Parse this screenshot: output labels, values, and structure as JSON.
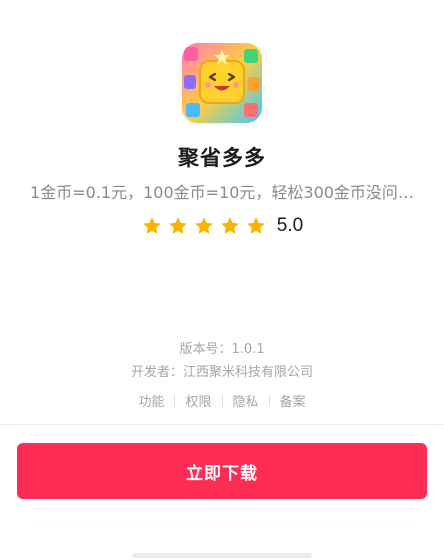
{
  "app": {
    "name": "聚省多多",
    "description": "1金币=0.1元，100金币=10元，轻松300金币没问…",
    "icon": "puzzle-game-app-icon"
  },
  "rating": {
    "stars": 5,
    "max_stars": 5,
    "score": "5.0",
    "star_color": "#f7b500"
  },
  "meta": {
    "version": "版本号：1.0.1",
    "developer": "开发者：江西聚米科技有限公司"
  },
  "links": [
    "功能",
    "权限",
    "隐私",
    "备案"
  ],
  "download": {
    "label": "立即下载",
    "color": "#fe2c55"
  }
}
